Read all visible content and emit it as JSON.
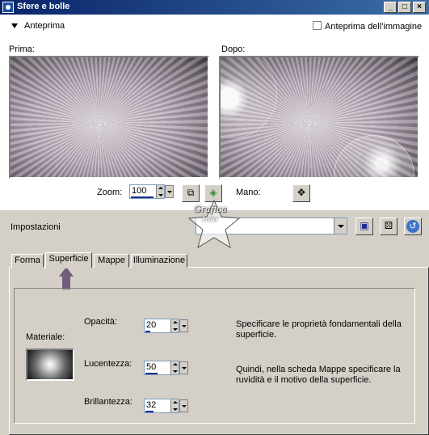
{
  "window": {
    "title": "Sfere e bolle",
    "min": "_",
    "max": "□",
    "close": "×"
  },
  "preview": {
    "toggle_label": "Anteprima",
    "image_preview_label": "Anteprima dell'immagine",
    "before_label": "Prima:",
    "after_label": "Dopo:",
    "zoom_label": "Zoom:",
    "zoom_value": "100",
    "mano_label": "Mano:"
  },
  "presets": {
    "label": "Impostazioni",
    "value": ""
  },
  "watermark": {
    "line1": "Grafica",
    "line2": "tuia"
  },
  "tabs": [
    {
      "label": "Forma"
    },
    {
      "label": "Superficie"
    },
    {
      "label": "Mappe"
    },
    {
      "label": "Illuminazione"
    }
  ],
  "surface": {
    "material_label": "Materiale:",
    "opacity_label": "Opacità:",
    "opacity_value": "20",
    "gloss_label": "Lucentezza:",
    "gloss_value": "50",
    "shininess_label": "Brillantezza:",
    "shininess_value": "32",
    "desc1": "Specificare le proprietà fondamentali della superficie.",
    "desc2": "Quindi, nella scheda Mappe specificare la ruvidità e il motivo della superficie."
  },
  "icons": [
    "app-icon",
    "fit-window-icon",
    "randomize-icon",
    "pan-icon",
    "save-preset-icon",
    "dice-icon",
    "reset-icon",
    "dropdown-icon"
  ],
  "colors": {
    "titlebar": "#0a246a",
    "face": "#d4d0c8",
    "accent_arrow": "#735b7d"
  }
}
